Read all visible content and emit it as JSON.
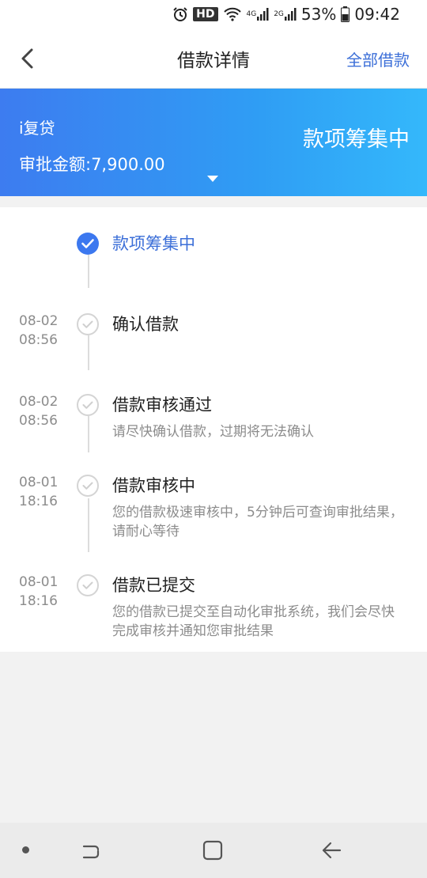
{
  "status_bar": {
    "hd": "HD",
    "net_4g": "4G",
    "net_2g": "2G",
    "battery": "53%",
    "time": "09:42"
  },
  "header": {
    "title": "借款详情",
    "right_link": "全部借款"
  },
  "banner": {
    "product": "i复贷",
    "amount": "审批金额:7,900.00",
    "status": "款项筹集中"
  },
  "timeline": [
    {
      "date": "",
      "time": "",
      "title": "款项筹集中",
      "desc": "",
      "state": "active"
    },
    {
      "date": "08-02",
      "time": "08:56",
      "title": "确认借款",
      "desc": "",
      "state": "done"
    },
    {
      "date": "08-02",
      "time": "08:56",
      "title": "借款审核通过",
      "desc": "请尽快确认借款，过期将无法确认",
      "state": "done"
    },
    {
      "date": "08-01",
      "time": "18:16",
      "title": "借款审核中",
      "desc": "您的借款极速审核中，5分钟后可查询审批结果，请耐心等待",
      "state": "done"
    },
    {
      "date": "08-01",
      "time": "18:16",
      "title": "借款已提交",
      "desc": "您的借款已提交至自动化审批系统，我们会尽快完成审核并通知您审批结果",
      "state": "done"
    }
  ],
  "colors": {
    "accent": "#3c6fd8",
    "banner_start": "#3d7cf0",
    "banner_end": "#34b8fb"
  }
}
